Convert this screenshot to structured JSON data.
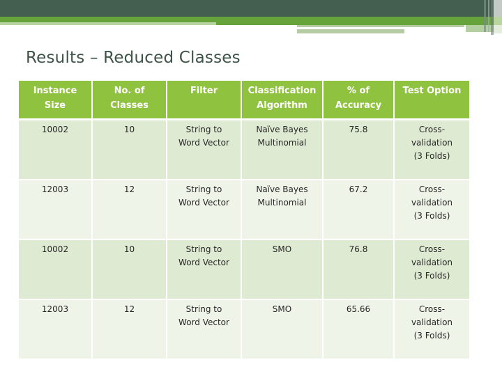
{
  "slide": {
    "title": "Results – Reduced Classes",
    "colors": {
      "header_band_dark": "#445f50",
      "header_band_green": "#66a43b",
      "title_text": "#3e5347",
      "table_header_bg": "#8fc23e",
      "table_row_odd_bg": "#dfead2",
      "table_row_even_bg": "#eff4e8"
    }
  },
  "table": {
    "columns": [
      "Instance\nSize",
      "No. of\nClasses",
      "Filter",
      "Classification\nAlgorithm",
      "% of\nAccuracy",
      "Test Option"
    ],
    "rows": [
      [
        "10002",
        "10",
        "String to\nWord Vector",
        "Naïve Bayes\nMultinomial",
        "75.8",
        "Cross-\nvalidation\n(3 Folds)"
      ],
      [
        "12003",
        "12",
        "String to\nWord Vector",
        "Naïve Bayes\nMultinomial",
        "67.2",
        "Cross-\nvalidation\n(3 Folds)"
      ],
      [
        "10002",
        "10",
        "String to\nWord Vector",
        "SMO",
        "76.8",
        "Cross-\nvalidation\n(3 Folds)"
      ],
      [
        "12003",
        "12",
        "String to\nWord Vector",
        "SMO",
        "65.66",
        "Cross-\nvalidation\n(3 Folds)"
      ]
    ]
  }
}
